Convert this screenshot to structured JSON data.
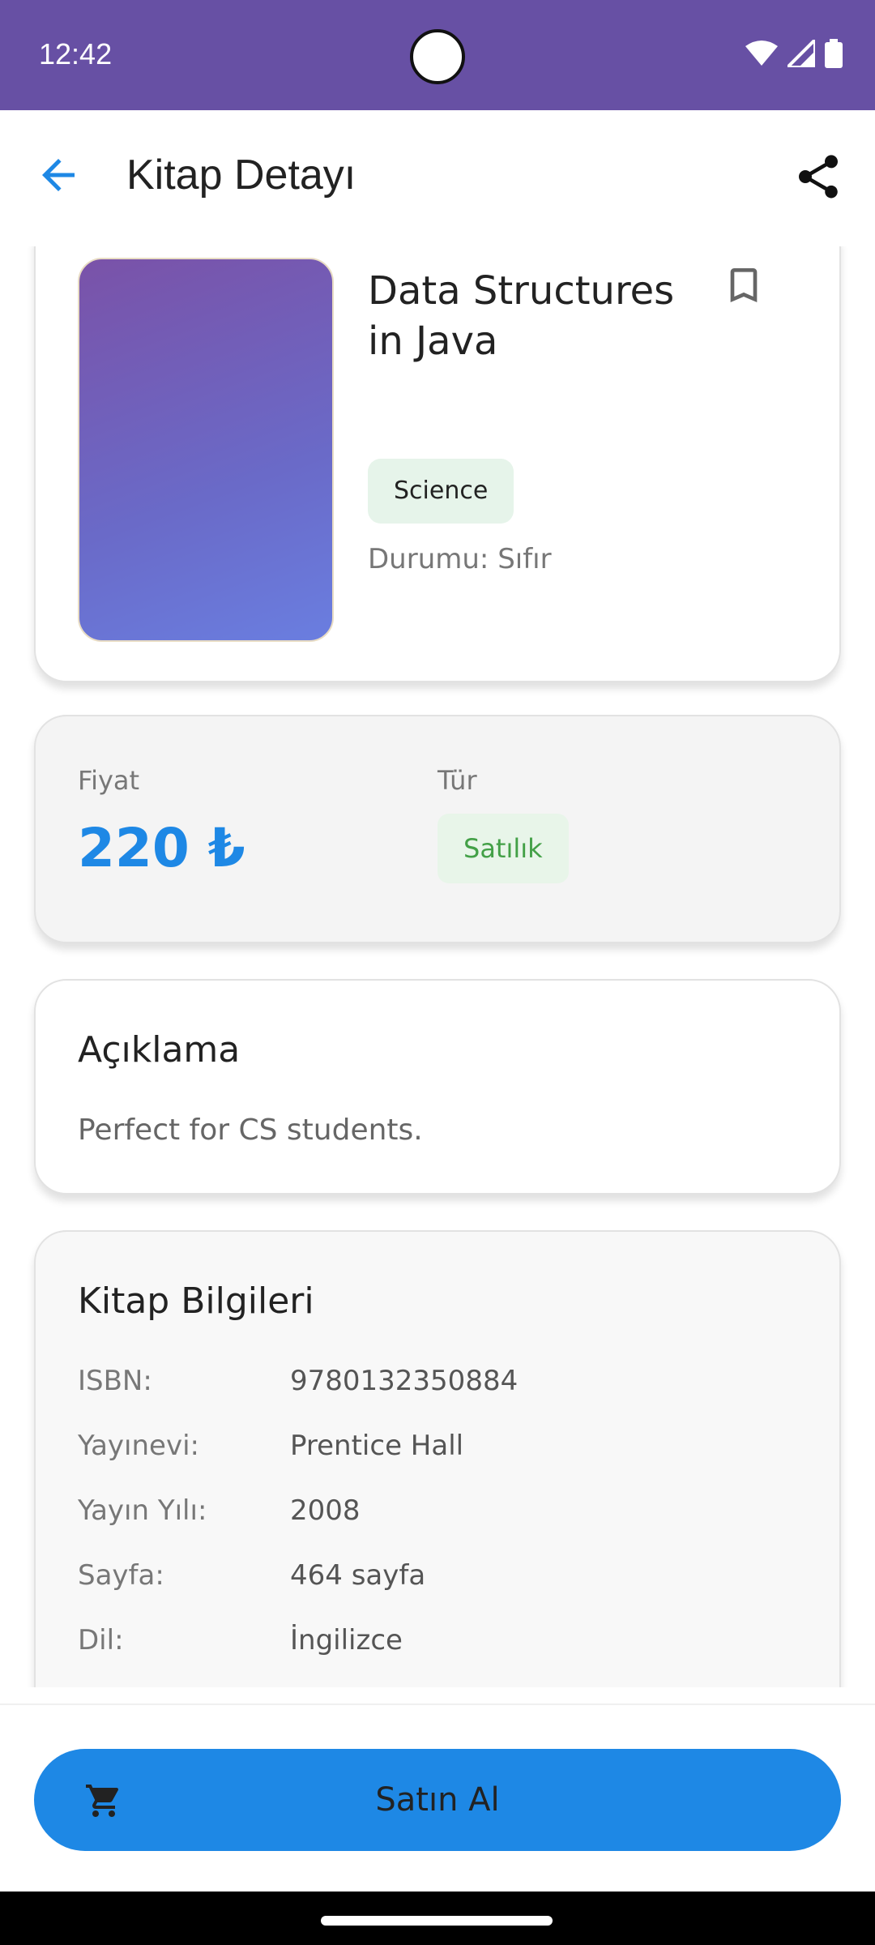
{
  "status_bar": {
    "time": "12:42",
    "icons": [
      "wifi-icon",
      "signal-icon",
      "battery-icon"
    ]
  },
  "app_bar": {
    "title": "Kitap Detayı",
    "back_icon": "arrow-back-icon",
    "share_icon": "share-icon"
  },
  "book": {
    "title": "Data Structures in Java",
    "category": "Science",
    "condition": "Durumu: Sıfır",
    "bookmark_icon": "bookmark-outline-icon"
  },
  "price_card": {
    "price_label": "Fiyat",
    "price_value": "220 ₺",
    "type_label": "Tür",
    "type_value": "Satılık"
  },
  "description": {
    "title": "Açıklama",
    "text": "Perfect for CS students."
  },
  "info": {
    "title": "Kitap Bilgileri",
    "rows": [
      {
        "key": "ISBN:",
        "value": "9780132350884"
      },
      {
        "key": "Yayınevi:",
        "value": "Prentice Hall"
      },
      {
        "key": "Yayın Yılı:",
        "value": "2008"
      },
      {
        "key": "Sayfa:",
        "value": "464 sayfa"
      },
      {
        "key": "Dil:",
        "value": "İngilizce"
      }
    ]
  },
  "buy_button": {
    "label": "Satın Al",
    "icon": "cart-icon"
  },
  "colors": {
    "status_bar": "#6750A4",
    "accent": "#1e88e5",
    "chip_green": "#43a047"
  }
}
